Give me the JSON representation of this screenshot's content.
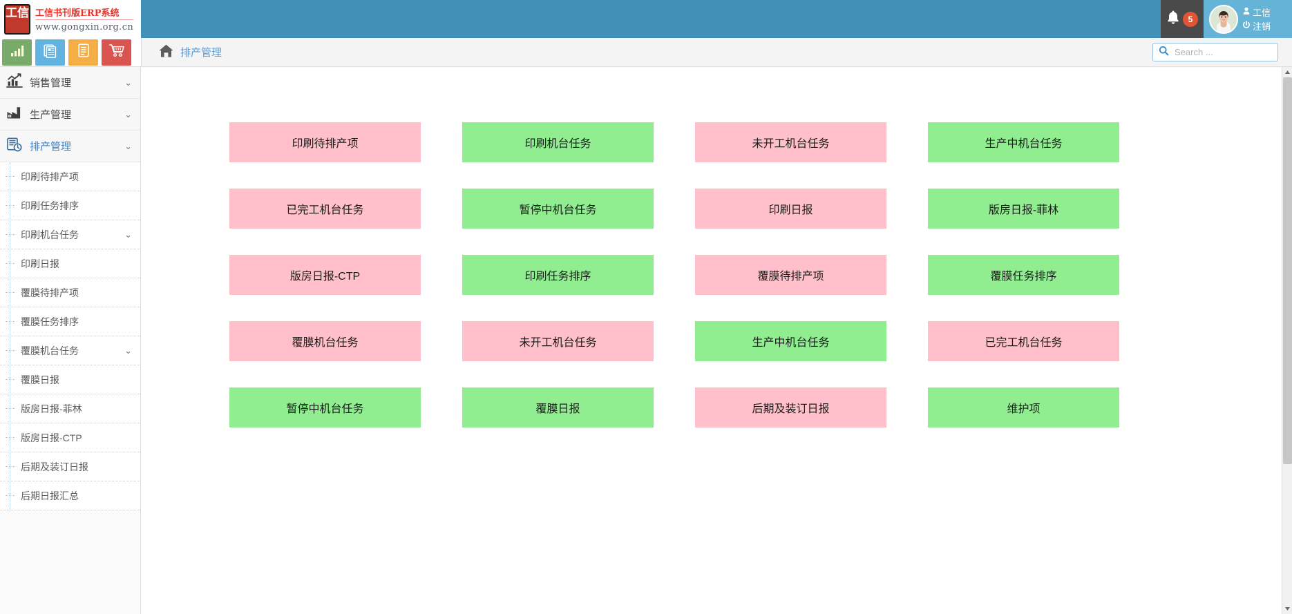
{
  "app": {
    "logo_text": "工信",
    "title": "工信书刊版ERP系统",
    "url": "www.gongxin.org.cn"
  },
  "header": {
    "notification_count": "5",
    "user_name": "工信",
    "logout_label": "注销",
    "bell_icon": "bell-icon",
    "user_icon": "user-icon",
    "power_icon": "power-icon"
  },
  "toolbar": {
    "buttons": [
      {
        "name": "chart-icon",
        "color": "#78ab6a"
      },
      {
        "name": "news-icon",
        "color": "#62b3e0"
      },
      {
        "name": "document-icon",
        "color": "#f5ad45"
      },
      {
        "name": "cart-icon",
        "color": "#d9534f"
      }
    ]
  },
  "breadcrumb": {
    "home_icon": "home-icon",
    "label": "排产管理"
  },
  "search": {
    "placeholder": "Search ...",
    "value": "",
    "icon": "search-icon"
  },
  "sidebar": {
    "groups": [
      {
        "label": "销售管理",
        "icon": "sales-chart-icon",
        "active": false,
        "chevron": "⌄"
      },
      {
        "label": "生产管理",
        "icon": "factory-icon",
        "active": false,
        "chevron": "⌄"
      },
      {
        "label": "排产管理",
        "icon": "schedule-clock-icon",
        "active": true,
        "chevron": "⌄"
      }
    ],
    "items": [
      {
        "label": "印刷待排产项",
        "chevron": ""
      },
      {
        "label": "印刷任务排序",
        "chevron": ""
      },
      {
        "label": "印刷机台任务",
        "chevron": "⌄"
      },
      {
        "label": "印刷日报",
        "chevron": ""
      },
      {
        "label": "覆膜待排产项",
        "chevron": ""
      },
      {
        "label": "覆膜任务排序",
        "chevron": ""
      },
      {
        "label": "覆膜机台任务",
        "chevron": "⌄"
      },
      {
        "label": "覆膜日报",
        "chevron": ""
      },
      {
        "label": "版房日报-菲林",
        "chevron": ""
      },
      {
        "label": "版房日报-CTP",
        "chevron": ""
      },
      {
        "label": "后期及装订日报",
        "chevron": ""
      },
      {
        "label": "后期日报汇总",
        "chevron": ""
      }
    ]
  },
  "main": {
    "tiles": [
      {
        "label": "印刷待排产项",
        "color": "pink"
      },
      {
        "label": "印刷机台任务",
        "color": "green"
      },
      {
        "label": "未开工机台任务",
        "color": "pink"
      },
      {
        "label": "生产中机台任务",
        "color": "green"
      },
      {
        "label": "已完工机台任务",
        "color": "pink"
      },
      {
        "label": "暂停中机台任务",
        "color": "green"
      },
      {
        "label": "印刷日报",
        "color": "pink"
      },
      {
        "label": "版房日报-菲林",
        "color": "green"
      },
      {
        "label": "版房日报-CTP",
        "color": "pink"
      },
      {
        "label": "印刷任务排序",
        "color": "green"
      },
      {
        "label": "覆膜待排产项",
        "color": "pink"
      },
      {
        "label": "覆膜任务排序",
        "color": "green"
      },
      {
        "label": "覆膜机台任务",
        "color": "pink"
      },
      {
        "label": "未开工机台任务",
        "color": "pink"
      },
      {
        "label": "生产中机台任务",
        "color": "green"
      },
      {
        "label": "已完工机台任务",
        "color": "pink"
      },
      {
        "label": "暂停中机台任务",
        "color": "green"
      },
      {
        "label": "覆膜日报",
        "color": "green"
      },
      {
        "label": "后期及装订日报",
        "color": "pink"
      },
      {
        "label": "维护项",
        "color": "green"
      }
    ]
  },
  "colors": {
    "header_blue": "#4190b8",
    "user_blue": "#65b3d6",
    "notif_dark": "#4a4a4a",
    "badge_red": "#e05535",
    "brand_red": "#e8342a",
    "tile_pink": "#ffc0cb",
    "tile_green": "#90ee90",
    "link_blue": "#5a9bd5"
  }
}
